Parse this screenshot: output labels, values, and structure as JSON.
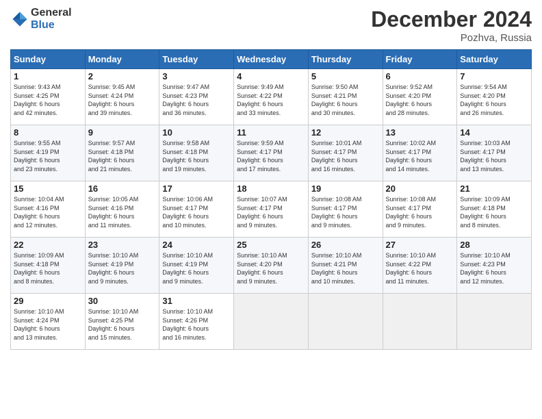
{
  "logo": {
    "general": "General",
    "blue": "Blue"
  },
  "title": "December 2024",
  "location": "Pozhva, Russia",
  "weekdays": [
    "Sunday",
    "Monday",
    "Tuesday",
    "Wednesday",
    "Thursday",
    "Friday",
    "Saturday"
  ],
  "weeks": [
    [
      {
        "day": "1",
        "info": "Sunrise: 9:43 AM\nSunset: 4:25 PM\nDaylight: 6 hours\nand 42 minutes."
      },
      {
        "day": "2",
        "info": "Sunrise: 9:45 AM\nSunset: 4:24 PM\nDaylight: 6 hours\nand 39 minutes."
      },
      {
        "day": "3",
        "info": "Sunrise: 9:47 AM\nSunset: 4:23 PM\nDaylight: 6 hours\nand 36 minutes."
      },
      {
        "day": "4",
        "info": "Sunrise: 9:49 AM\nSunset: 4:22 PM\nDaylight: 6 hours\nand 33 minutes."
      },
      {
        "day": "5",
        "info": "Sunrise: 9:50 AM\nSunset: 4:21 PM\nDaylight: 6 hours\nand 30 minutes."
      },
      {
        "day": "6",
        "info": "Sunrise: 9:52 AM\nSunset: 4:20 PM\nDaylight: 6 hours\nand 28 minutes."
      },
      {
        "day": "7",
        "info": "Sunrise: 9:54 AM\nSunset: 4:20 PM\nDaylight: 6 hours\nand 26 minutes."
      }
    ],
    [
      {
        "day": "8",
        "info": "Sunrise: 9:55 AM\nSunset: 4:19 PM\nDaylight: 6 hours\nand 23 minutes."
      },
      {
        "day": "9",
        "info": "Sunrise: 9:57 AM\nSunset: 4:18 PM\nDaylight: 6 hours\nand 21 minutes."
      },
      {
        "day": "10",
        "info": "Sunrise: 9:58 AM\nSunset: 4:18 PM\nDaylight: 6 hours\nand 19 minutes."
      },
      {
        "day": "11",
        "info": "Sunrise: 9:59 AM\nSunset: 4:17 PM\nDaylight: 6 hours\nand 17 minutes."
      },
      {
        "day": "12",
        "info": "Sunrise: 10:01 AM\nSunset: 4:17 PM\nDaylight: 6 hours\nand 16 minutes."
      },
      {
        "day": "13",
        "info": "Sunrise: 10:02 AM\nSunset: 4:17 PM\nDaylight: 6 hours\nand 14 minutes."
      },
      {
        "day": "14",
        "info": "Sunrise: 10:03 AM\nSunset: 4:17 PM\nDaylight: 6 hours\nand 13 minutes."
      }
    ],
    [
      {
        "day": "15",
        "info": "Sunrise: 10:04 AM\nSunset: 4:16 PM\nDaylight: 6 hours\nand 12 minutes."
      },
      {
        "day": "16",
        "info": "Sunrise: 10:05 AM\nSunset: 4:16 PM\nDaylight: 6 hours\nand 11 minutes."
      },
      {
        "day": "17",
        "info": "Sunrise: 10:06 AM\nSunset: 4:17 PM\nDaylight: 6 hours\nand 10 minutes."
      },
      {
        "day": "18",
        "info": "Sunrise: 10:07 AM\nSunset: 4:17 PM\nDaylight: 6 hours\nand 9 minutes."
      },
      {
        "day": "19",
        "info": "Sunrise: 10:08 AM\nSunset: 4:17 PM\nDaylight: 6 hours\nand 9 minutes."
      },
      {
        "day": "20",
        "info": "Sunrise: 10:08 AM\nSunset: 4:17 PM\nDaylight: 6 hours\nand 9 minutes."
      },
      {
        "day": "21",
        "info": "Sunrise: 10:09 AM\nSunset: 4:18 PM\nDaylight: 6 hours\nand 8 minutes."
      }
    ],
    [
      {
        "day": "22",
        "info": "Sunrise: 10:09 AM\nSunset: 4:18 PM\nDaylight: 6 hours\nand 8 minutes."
      },
      {
        "day": "23",
        "info": "Sunrise: 10:10 AM\nSunset: 4:19 PM\nDaylight: 6 hours\nand 9 minutes."
      },
      {
        "day": "24",
        "info": "Sunrise: 10:10 AM\nSunset: 4:19 PM\nDaylight: 6 hours\nand 9 minutes."
      },
      {
        "day": "25",
        "info": "Sunrise: 10:10 AM\nSunset: 4:20 PM\nDaylight: 6 hours\nand 9 minutes."
      },
      {
        "day": "26",
        "info": "Sunrise: 10:10 AM\nSunset: 4:21 PM\nDaylight: 6 hours\nand 10 minutes."
      },
      {
        "day": "27",
        "info": "Sunrise: 10:10 AM\nSunset: 4:22 PM\nDaylight: 6 hours\nand 11 minutes."
      },
      {
        "day": "28",
        "info": "Sunrise: 10:10 AM\nSunset: 4:23 PM\nDaylight: 6 hours\nand 12 minutes."
      }
    ],
    [
      {
        "day": "29",
        "info": "Sunrise: 10:10 AM\nSunset: 4:24 PM\nDaylight: 6 hours\nand 13 minutes."
      },
      {
        "day": "30",
        "info": "Sunrise: 10:10 AM\nSunset: 4:25 PM\nDaylight: 6 hours\nand 15 minutes."
      },
      {
        "day": "31",
        "info": "Sunrise: 10:10 AM\nSunset: 4:26 PM\nDaylight: 6 hours\nand 16 minutes."
      },
      {
        "day": "",
        "info": ""
      },
      {
        "day": "",
        "info": ""
      },
      {
        "day": "",
        "info": ""
      },
      {
        "day": "",
        "info": ""
      }
    ]
  ]
}
